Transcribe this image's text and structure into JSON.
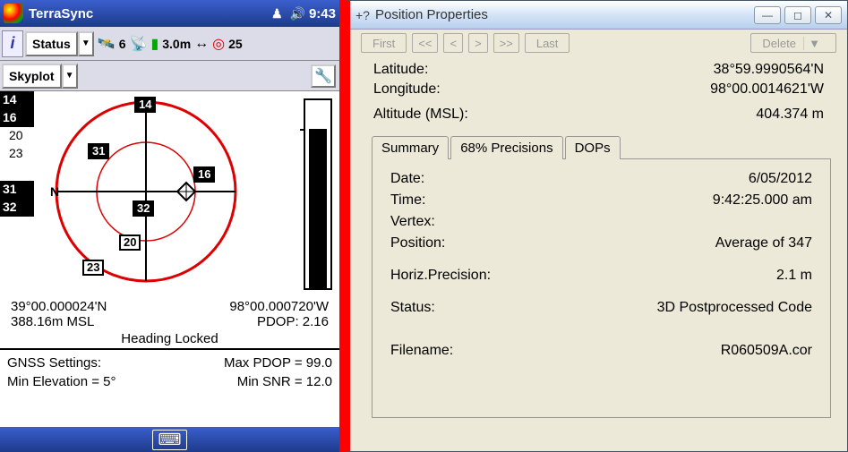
{
  "terrasync": {
    "title": "TerraSync",
    "clock": "9:43",
    "status_label": "Status",
    "skyplot_label": "Skyplot",
    "toolbar": {
      "sat_count": "6",
      "accuracy": "3.0m",
      "target_count": "25"
    },
    "satellites": [
      {
        "prn": "14",
        "used": true
      },
      {
        "prn": "16",
        "used": true
      },
      {
        "prn": "20",
        "used": false
      },
      {
        "prn": "23",
        "used": false
      },
      {
        "prn": "31",
        "used": true
      },
      {
        "prn": "32",
        "used": true
      }
    ],
    "compass_n": "N",
    "coords": {
      "lat": "39°00.000024'N",
      "lon": "98°00.000720'W",
      "alt": "388.16m MSL",
      "pdop": "PDOP: 2.16",
      "heading": "Heading Locked"
    },
    "settings": {
      "gnss_label": "GNSS Settings:",
      "max_pdop": "Max PDOP = 99.0",
      "min_elev": "Min Elevation = 5°",
      "min_snr": "Min SNR = 12.0"
    }
  },
  "posprops": {
    "title": "Position Properties",
    "nav": {
      "first": "First",
      "last": "Last",
      "delete": "Delete"
    },
    "lat_label": "Latitude:",
    "lat_val": "38°59.9990564'N",
    "lon_label": "Longitude:",
    "lon_val": "98°00.0014621'W",
    "alt_label": "Altitude (MSL):",
    "alt_val": "404.374 m",
    "tabs": {
      "summary": "Summary",
      "precisions": "68% Precisions",
      "dops": "DOPs"
    },
    "summary": {
      "date_label": "Date:",
      "date_val": "6/05/2012",
      "time_label": "Time:",
      "time_val": "9:42:25.000 am",
      "vertex_label": "Vertex:",
      "vertex_val": "",
      "position_label": "Position:",
      "position_val": "Average of 347",
      "hprec_label": "Horiz.Precision:",
      "hprec_val": "2.1 m",
      "status_label": "Status:",
      "status_val": "3D Postprocessed Code",
      "filename_label": "Filename:",
      "filename_val": "R060509A.cor"
    }
  }
}
